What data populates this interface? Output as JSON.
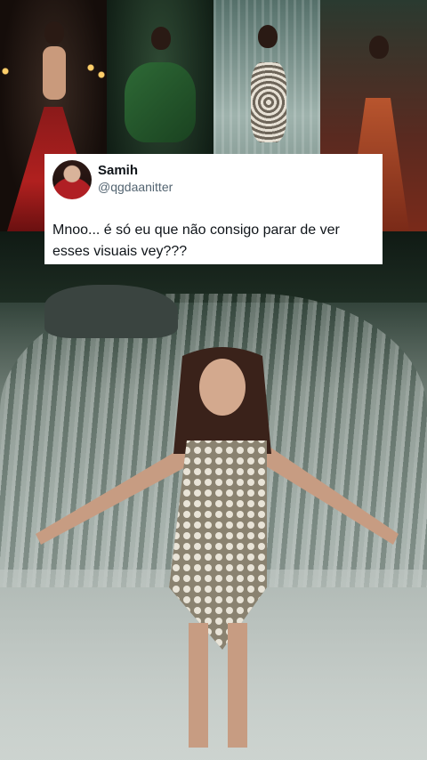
{
  "tweet": {
    "display_name": "Samih",
    "handle": "@qgdaanitter",
    "text": "Mnoo... é só eu que não consigo parar de ver esses visuais vey???",
    "background_color": "#ffffff",
    "name_color": "#0f1419",
    "handle_color": "#536471"
  },
  "images": {
    "top_strip_panels": 4
  }
}
